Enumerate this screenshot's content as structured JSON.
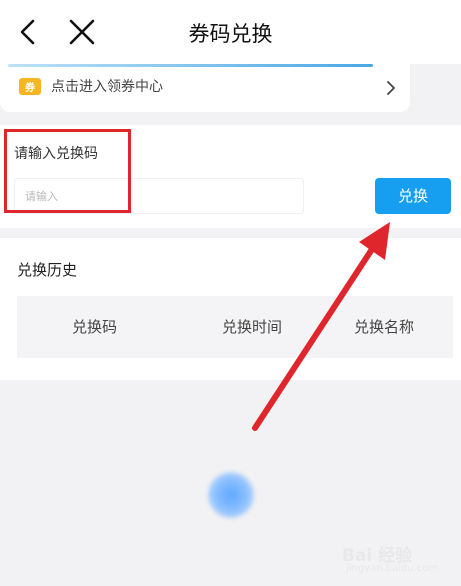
{
  "header": {
    "title": "券码兑换",
    "back_icon": "back-chevron-icon",
    "close_icon": "close-icon"
  },
  "banner": {
    "icon_glyph": "券",
    "label": "点击进入领券中心"
  },
  "redeem": {
    "caption": "请输入兑换码",
    "placeholder": "请输入",
    "button_label": "兑换"
  },
  "history": {
    "title": "兑换历史",
    "columns": [
      "兑换码",
      "兑换时间",
      "兑换名称"
    ]
  },
  "watermark": {
    "text": "Bai 经验",
    "sub": "jingyan.baidu.com"
  },
  "colors": {
    "accent": "#169ff0",
    "highlight": "#e0262d",
    "coupon": "#f6b622"
  }
}
